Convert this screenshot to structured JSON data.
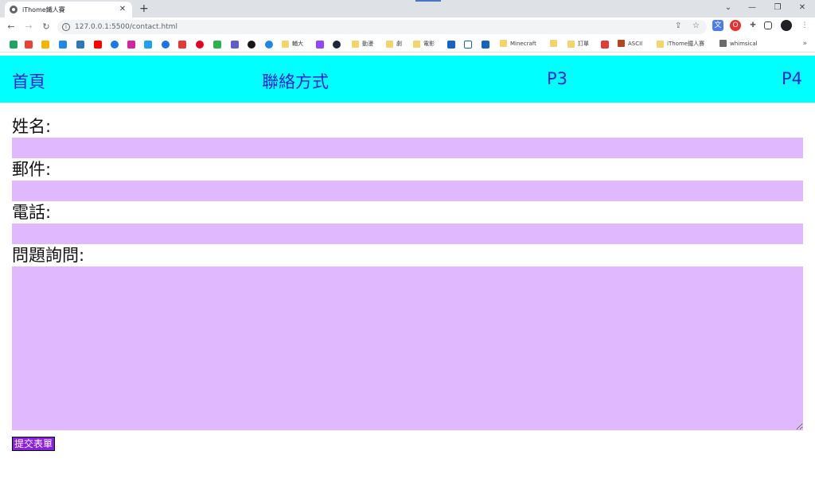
{
  "browser": {
    "tab_title": "iThome鐵人賽",
    "tab_close": "✕",
    "new_tab": "+",
    "url": "127.0.0.1:5500/contact.html",
    "window_controls": [
      "⌄",
      "—",
      "❐",
      "✕"
    ],
    "nav_icons": [
      "back-icon",
      "forward-icon",
      "reload-icon"
    ],
    "bookmark_folders": [
      {
        "label": "輔大",
        "kind": "folder"
      },
      {
        "label": "動漫",
        "kind": "folder"
      },
      {
        "label": "劇",
        "kind": "folder"
      },
      {
        "label": "電影",
        "kind": "folder"
      },
      {
        "label": "Minecraft",
        "kind": "folder"
      },
      {
        "label": "",
        "kind": "folder"
      },
      {
        "label": "訂單",
        "kind": "folder"
      },
      {
        "label": "ASCII",
        "kind": "bookmark"
      },
      {
        "label": "iThome鐵人賽",
        "kind": "folder"
      },
      {
        "label": "whimsical",
        "kind": "dark-folder"
      }
    ],
    "bookmarks_more": "»"
  },
  "nav": {
    "items": [
      "首頁",
      "聯絡方式",
      "P3",
      "P4"
    ],
    "background": "#00ffff",
    "link_color": "#1f1fd6"
  },
  "form": {
    "name_label": "姓名:",
    "email_label": "郵件:",
    "phone_label": "電話:",
    "question_label": "問題詢問:",
    "field_color": "#e0b8fe",
    "submit_label": "提交表單",
    "submit_color": "#8b1fe0"
  }
}
